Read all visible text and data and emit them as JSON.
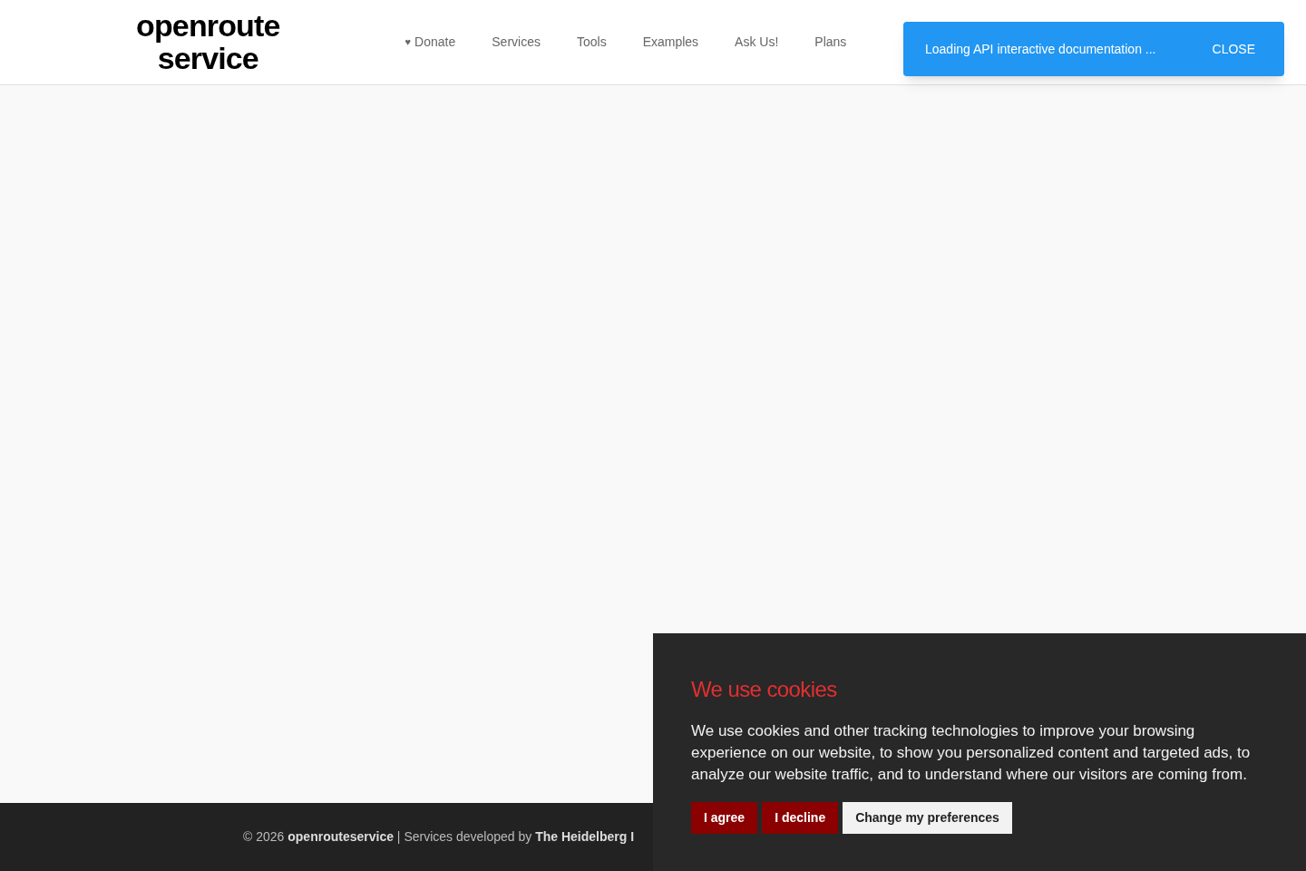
{
  "header": {
    "logo": [
      "openroute",
      "service"
    ],
    "nav": [
      {
        "icon": "♥",
        "label": "Donate"
      },
      {
        "label": "Services"
      },
      {
        "label": "Tools"
      },
      {
        "label": "Examples"
      },
      {
        "label": "Ask Us!"
      },
      {
        "label": "Plans"
      }
    ]
  },
  "toast": {
    "message": "Loading API interactive documentation ...",
    "action": "CLOSE"
  },
  "footer": {
    "text": "© 2026 **openrouteservice** | Services developed by **The Heidelberg I**"
  },
  "cookie_banner": {
    "title": "We use cookies",
    "body": "We use cookies and other tracking technologies to improve your browsing experience on our website, to show you personalized content and targeted ads, to analyze our website traffic, and to understand where our visitors are coming from.",
    "buttons": [
      {
        "kind": "primary",
        "label": "I agree"
      },
      {
        "kind": "primary",
        "label": "I decline"
      },
      {
        "kind": "secondary",
        "label": "Change my preferences"
      }
    ]
  }
}
